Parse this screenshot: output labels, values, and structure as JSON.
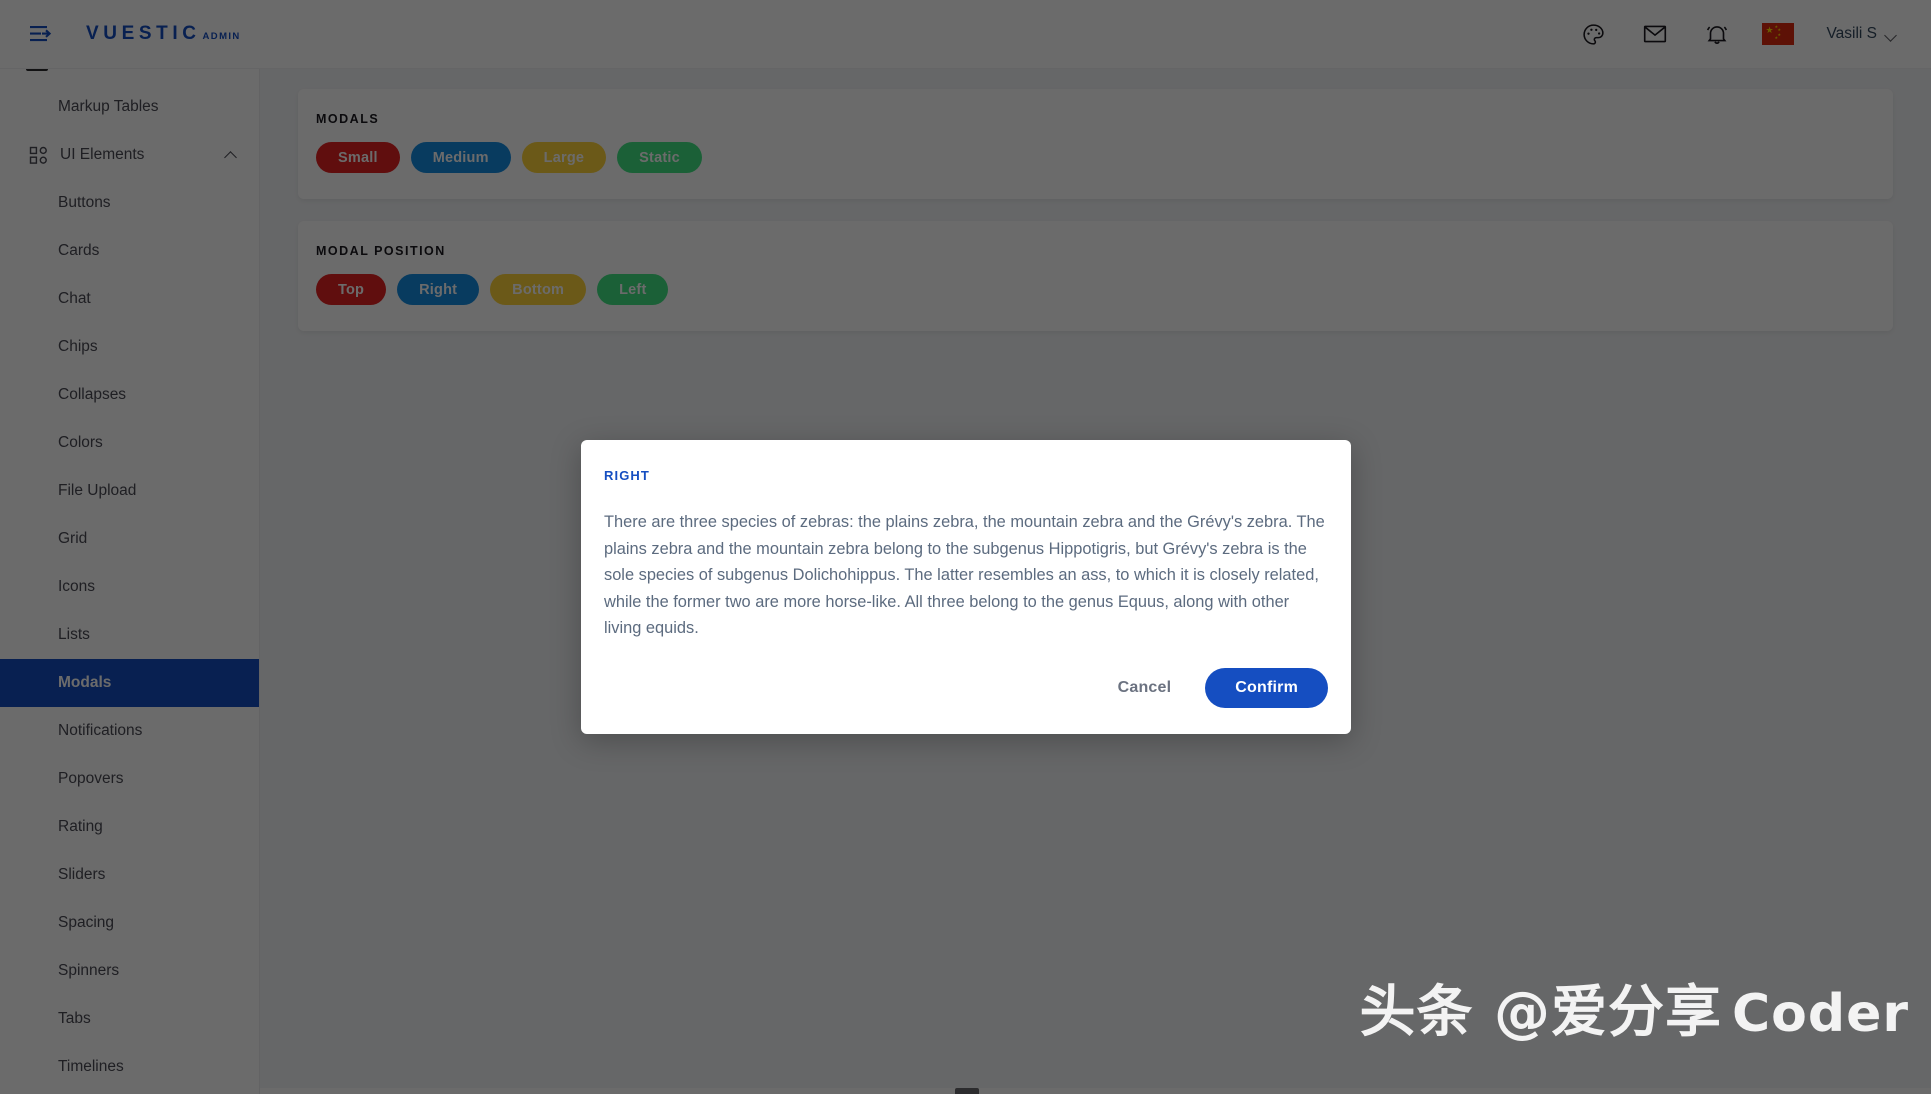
{
  "navbar": {
    "burger_icon": "hamburger-arrow-icon",
    "brand_main": "VUESTIC",
    "brand_sub": "ADMIN",
    "icons": [
      {
        "name": "palette-icon",
        "label": "Color theme"
      },
      {
        "name": "mail-icon",
        "label": "Messages"
      },
      {
        "name": "bell-icon",
        "label": "Notifications"
      }
    ],
    "language_flag": "china-flag",
    "user_name": "Vasili S",
    "user_caret": "chevron-down-icon"
  },
  "sidebar": {
    "items": [
      {
        "label": "Markup Tables",
        "level": "child",
        "icon": null,
        "active": false,
        "caret": false
      },
      {
        "label": "UI Elements",
        "level": "parent",
        "icon": "ui-elements-icon",
        "active": false,
        "caret": true
      },
      {
        "label": "Buttons",
        "level": "child",
        "icon": null,
        "active": false,
        "caret": false
      },
      {
        "label": "Cards",
        "level": "child",
        "icon": null,
        "active": false,
        "caret": false
      },
      {
        "label": "Chat",
        "level": "child",
        "icon": null,
        "active": false,
        "caret": false
      },
      {
        "label": "Chips",
        "level": "child",
        "icon": null,
        "active": false,
        "caret": false
      },
      {
        "label": "Collapses",
        "level": "child",
        "icon": null,
        "active": false,
        "caret": false
      },
      {
        "label": "Colors",
        "level": "child",
        "icon": null,
        "active": false,
        "caret": false
      },
      {
        "label": "File Upload",
        "level": "child",
        "icon": null,
        "active": false,
        "caret": false
      },
      {
        "label": "Grid",
        "level": "child",
        "icon": null,
        "active": false,
        "caret": false
      },
      {
        "label": "Icons",
        "level": "child",
        "icon": null,
        "active": false,
        "caret": false
      },
      {
        "label": "Lists",
        "level": "child",
        "icon": null,
        "active": false,
        "caret": false
      },
      {
        "label": "Modals",
        "level": "child",
        "icon": null,
        "active": true,
        "caret": false
      },
      {
        "label": "Notifications",
        "level": "child",
        "icon": null,
        "active": false,
        "caret": false
      },
      {
        "label": "Popovers",
        "level": "child",
        "icon": null,
        "active": false,
        "caret": false
      },
      {
        "label": "Rating",
        "level": "child",
        "icon": null,
        "active": false,
        "caret": false
      },
      {
        "label": "Sliders",
        "level": "child",
        "icon": null,
        "active": false,
        "caret": false
      },
      {
        "label": "Spacing",
        "level": "child",
        "icon": null,
        "active": false,
        "caret": false
      },
      {
        "label": "Spinners",
        "level": "child",
        "icon": null,
        "active": false,
        "caret": false
      },
      {
        "label": "Tabs",
        "level": "child",
        "icon": null,
        "active": false,
        "caret": false
      },
      {
        "label": "Timelines",
        "level": "child",
        "icon": null,
        "active": false,
        "caret": false
      }
    ]
  },
  "main": {
    "modals_card": {
      "title": "MODALS",
      "buttons": [
        {
          "label": "Small",
          "variant": "danger",
          "focused": false
        },
        {
          "label": "Medium",
          "variant": "info",
          "focused": false
        },
        {
          "label": "Large",
          "variant": "warning",
          "focused": false
        },
        {
          "label": "Static",
          "variant": "success",
          "focused": false
        }
      ]
    },
    "modal_position_card": {
      "title": "MODAL POSITION",
      "buttons": [
        {
          "label": "Top",
          "variant": "danger",
          "focused": false
        },
        {
          "label": "Right",
          "variant": "info",
          "focused": true
        },
        {
          "label": "Bottom",
          "variant": "warning",
          "focused": false
        },
        {
          "label": "Left",
          "variant": "success",
          "focused": false
        }
      ]
    }
  },
  "modal": {
    "title": "RIGHT",
    "body": "There are three species of zebras: the plains zebra, the mountain zebra and the Grévy's zebra. The plains zebra and the mountain zebra belong to the subgenus Hippotigris, but Grévy's zebra is the sole species of subgenus Dolichohippus. The latter resembles an ass, to which it is closely related, while the former two are more horse-like. All three belong to the genus Equus, along with other living equids.",
    "cancel_label": "Cancel",
    "confirm_label": "Confirm"
  },
  "watermark": {
    "zh": "头条 @爱分享",
    "en": "Coder"
  },
  "colors": {
    "brand": "#154ec1",
    "active_item": "#154ec1",
    "danger": "#e42222",
    "info": "#158de3",
    "warning": "#ffd43a",
    "success": "#40e583",
    "page_bg": "#f4f6f8",
    "overlay": "rgba(0,0,0,0.58)"
  }
}
